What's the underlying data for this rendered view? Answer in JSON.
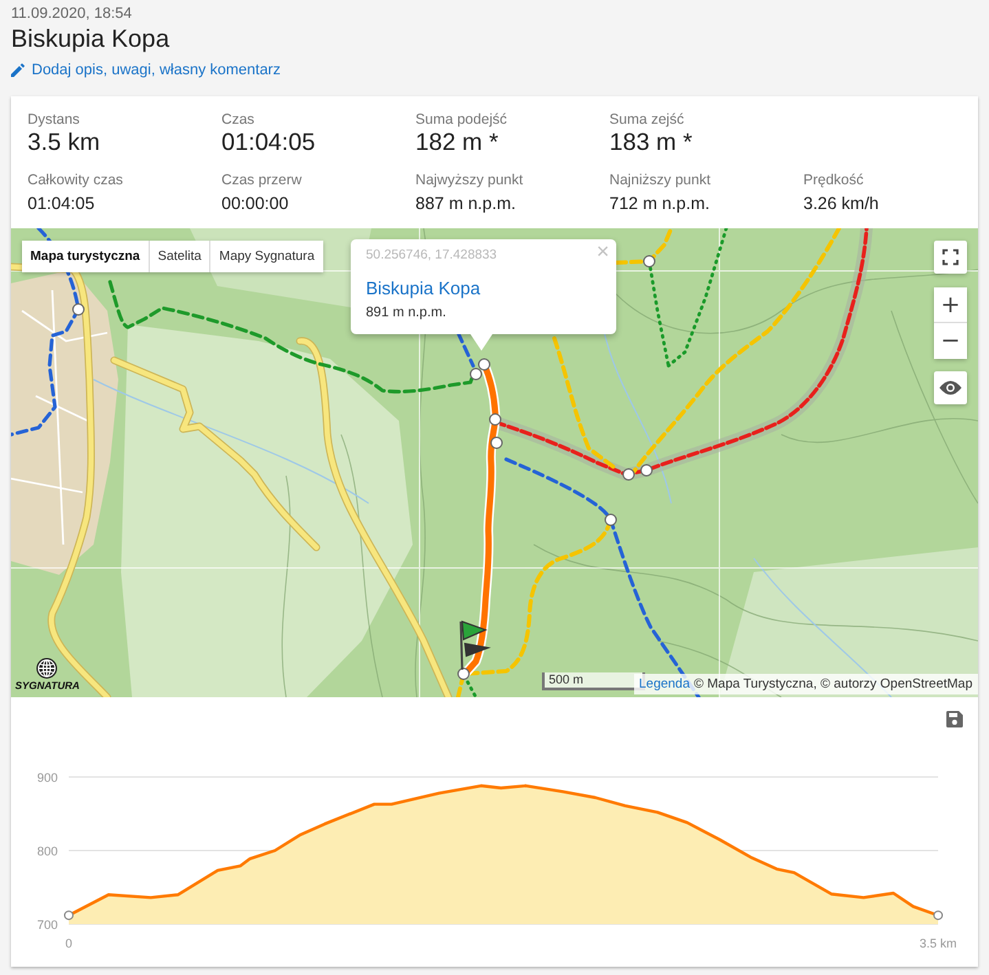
{
  "header": {
    "date": "11.09.2020, 18:54",
    "title": "Biskupia Kopa",
    "edit_link": "Dodaj opis, uwagi, własny komentarz"
  },
  "stats": {
    "main": [
      {
        "label": "Dystans",
        "value": "3.5 km"
      },
      {
        "label": "Czas",
        "value": "01:04:05"
      },
      {
        "label": "Suma podejść",
        "value": "182 m *"
      },
      {
        "label": "Suma zejść",
        "value": "183 m *"
      }
    ],
    "details": [
      {
        "label": "Całkowity czas",
        "value": "01:04:05"
      },
      {
        "label": "Czas przerw",
        "value": "00:00:00"
      },
      {
        "label": "Najwyższy punkt",
        "value": "887 m n.p.m."
      },
      {
        "label": "Najniższy punkt",
        "value": "712 m n.p.m."
      },
      {
        "label": "Prędkość",
        "value": "3.26 km/h"
      }
    ]
  },
  "map": {
    "layers": [
      {
        "label": "Mapa turystyczna",
        "selected": true
      },
      {
        "label": "Satelita",
        "selected": false
      },
      {
        "label": "Mapy Sygnatura",
        "selected": false
      }
    ],
    "popup": {
      "coordinates": "50.256746, 17.428833",
      "title": "Biskupia Kopa",
      "elevation": "891 m n.p.m.",
      "close": "×"
    },
    "zoom_in": "+",
    "zoom_out": "−",
    "scale": "500 m",
    "attribution": {
      "link": "Legenda",
      "text": "© Mapa Turystyczna, © autorzy OpenStreetMap"
    },
    "logo": "SYGNATURA"
  },
  "elevation_chart": {
    "chart_data": {
      "type": "area",
      "x": [
        0,
        0.16,
        0.33,
        0.44,
        0.6,
        0.69,
        0.73,
        0.83,
        0.93,
        1.03,
        1.23,
        1.3,
        1.49,
        1.66,
        1.74,
        1.84,
        1.99,
        2.12,
        2.24,
        2.37,
        2.49,
        2.62,
        2.75,
        2.85,
        2.92,
        3.07,
        3.2,
        3.32,
        3.4,
        3.5
      ],
      "values": [
        712,
        740,
        736,
        740,
        773,
        779,
        789,
        800,
        821,
        836,
        863,
        863,
        878,
        888,
        885,
        888,
        880,
        872,
        861,
        852,
        838,
        815,
        790,
        775,
        770,
        741,
        736,
        742,
        724,
        712
      ],
      "xlim": [
        0,
        3.5
      ],
      "ylim": [
        700,
        900
      ],
      "yticks": [
        700,
        800,
        900
      ],
      "xticks": [
        {
          "value": 0,
          "label": "0"
        },
        {
          "value": 3.5,
          "label": "3.5 km"
        }
      ]
    }
  }
}
